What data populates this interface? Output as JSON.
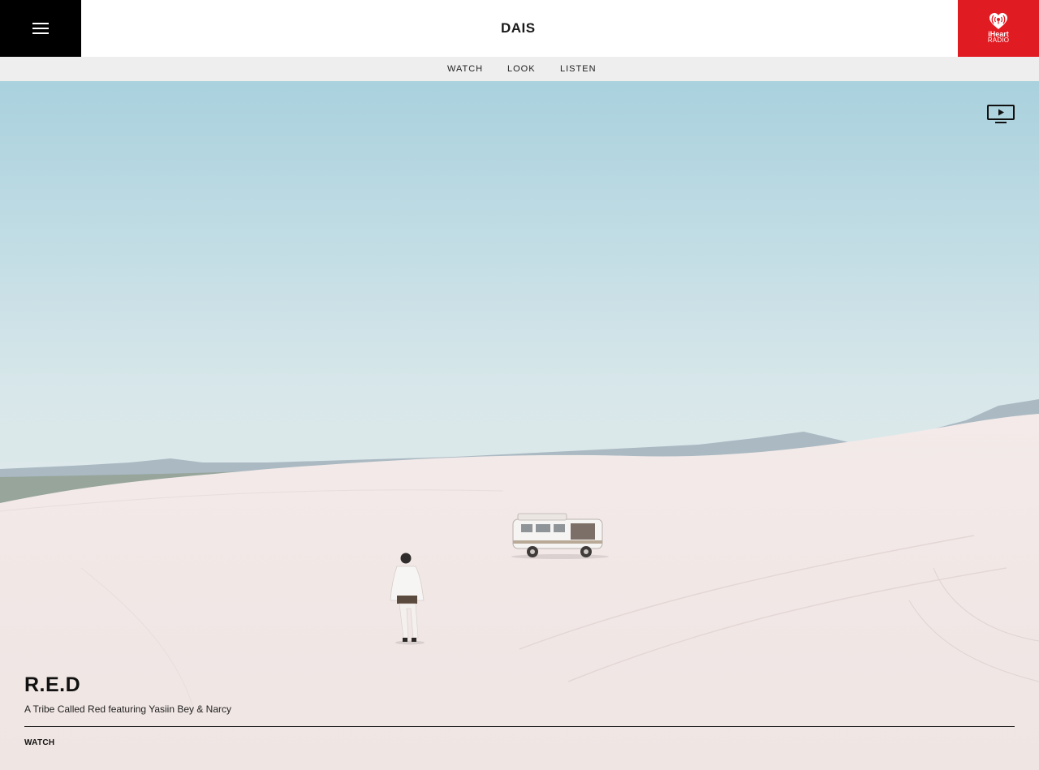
{
  "header": {
    "logo_text": "DAIS",
    "iheart_line1": "iHeart",
    "iheart_line2": "RADIO"
  },
  "nav": {
    "items": [
      "WATCH",
      "LOOK",
      "LISTEN"
    ]
  },
  "feature": {
    "title": "R.E.D",
    "subtitle": "A Tribe Called Red featuring Yasiin Bey & Narcy",
    "cta": "WATCH"
  },
  "icons": {
    "menu": "hamburger-menu-icon",
    "iheart": "iheart-radio-icon",
    "video": "tv-play-icon"
  },
  "colors": {
    "menu_bg": "#000000",
    "iheart_red": "#e11b22",
    "subnav_bg": "#eeeeee",
    "sky_top": "#a9d1de",
    "sand": "#f2e9e8"
  }
}
